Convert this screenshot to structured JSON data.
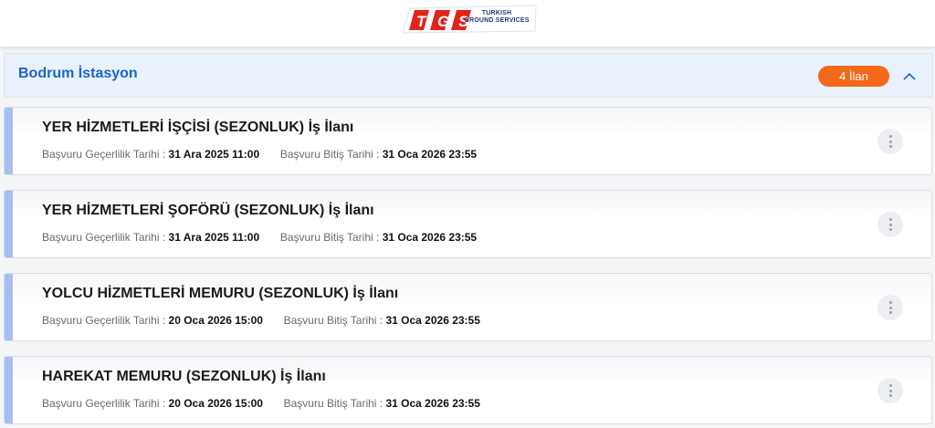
{
  "header": {
    "logo_letters": "TGS",
    "logo_line1": "TURKISH",
    "logo_line2": "GROUND SERVICES",
    "logo_icon": "tgs-logo"
  },
  "section": {
    "title": "Bodrum İstasyon",
    "count_badge": "4 İlan",
    "toggle_icon": "chevron-up-icon",
    "accent_color": "#1a66c9",
    "badge_color": "#f2691a"
  },
  "jobs": [
    {
      "title": "YER HİZMETLERİ İŞÇİSİ (SEZONLUK) İş İlanı",
      "start_label": "Başvuru Geçerlilik Tarihi :",
      "start_value": "31 Ara 2025 11:00",
      "end_label": "Başvuru Bitiş Tarihi :",
      "end_value": "31 Oca 2026 23:55"
    },
    {
      "title": "YER HİZMETLERİ ŞOFÖRÜ (SEZONLUK) İş İlanı",
      "start_label": "Başvuru Geçerlilik Tarihi :",
      "start_value": "31 Ara 2025 11:00",
      "end_label": "Başvuru Bitiş Tarihi :",
      "end_value": "31 Oca 2026 23:55"
    },
    {
      "title": "YOLCU HİZMETLERİ MEMURU (SEZONLUK) İş İlanı",
      "start_label": "Başvuru Geçerlilik Tarihi :",
      "start_value": "20 Oca 2026 15:00",
      "end_label": "Başvuru Bitiş Tarihi :",
      "end_value": "31 Oca 2026 23:55"
    },
    {
      "title": "HAREKAT MEMURU (SEZONLUK) İş İlanı",
      "start_label": "Başvuru Geçerlilik Tarihi :",
      "start_value": "20 Oca 2026 15:00",
      "end_label": "Başvuru Bitiş Tarihi :",
      "end_value": "31 Oca 2026 23:55"
    }
  ]
}
